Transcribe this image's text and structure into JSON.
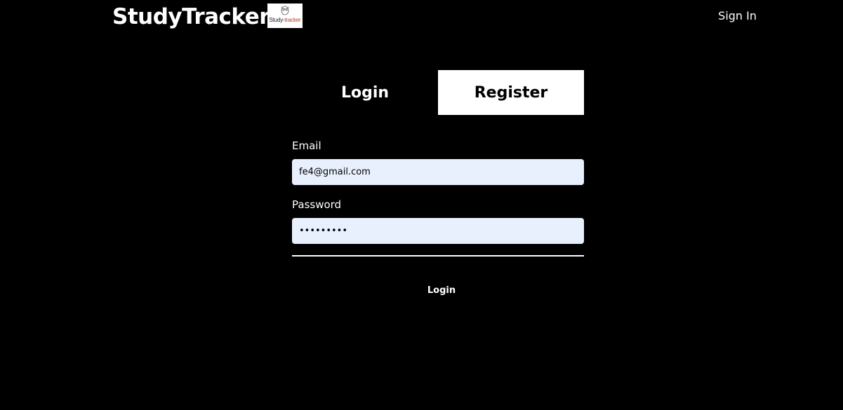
{
  "header": {
    "brand_title": "StudyTracker",
    "logo_text_prefix": "Study-",
    "logo_text_accent": "tracker",
    "logo_icon": "owl-logo-icon",
    "sign_in_label": "Sign In"
  },
  "auth": {
    "tabs": [
      {
        "label": "Login",
        "active": true
      },
      {
        "label": "Register",
        "active": false
      }
    ],
    "email_label": "Email",
    "email_value": "fe4@gmail.com",
    "password_label": "Password",
    "password_value": "fe4pass12",
    "submit_label": "Login"
  },
  "colors": {
    "background": "#000000",
    "text": "#ffffff",
    "input_background": "#e8f0fe",
    "accent": "#c0392b"
  }
}
